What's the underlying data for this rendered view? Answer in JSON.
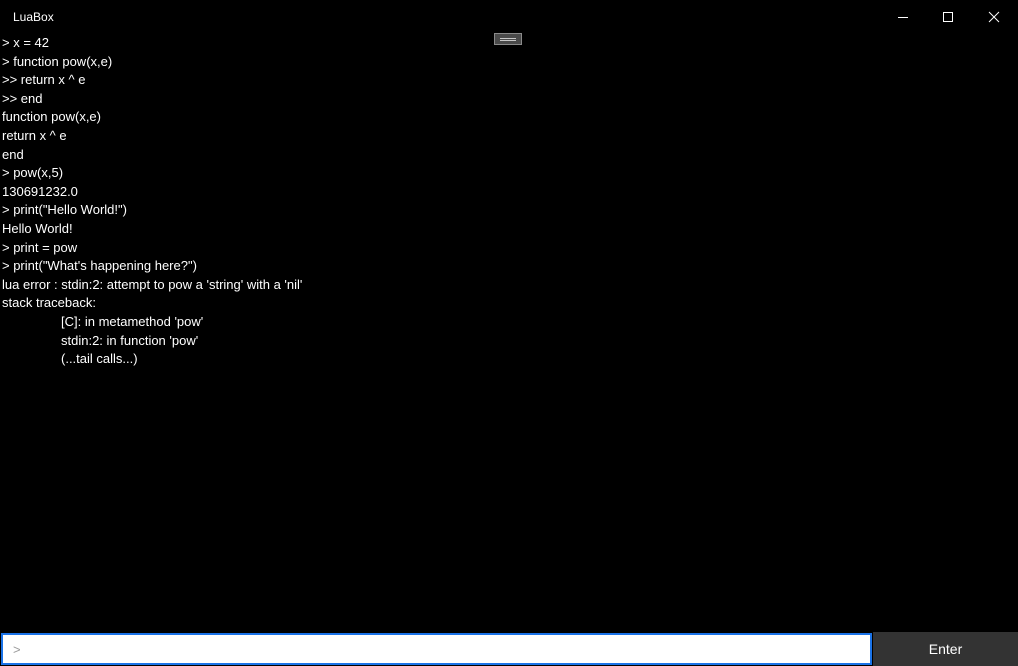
{
  "window": {
    "title": "LuaBox"
  },
  "console": {
    "lines": [
      {
        "text": "> x = 42",
        "indent": false
      },
      {
        "text": "> function pow(x,e)",
        "indent": false
      },
      {
        "text": ">> return x ^ e",
        "indent": false
      },
      {
        "text": ">> end",
        "indent": false
      },
      {
        "text": "function pow(x,e)",
        "indent": false
      },
      {
        "text": "return x ^ e",
        "indent": false
      },
      {
        "text": "end",
        "indent": false
      },
      {
        "text": "> pow(x,5)",
        "indent": false
      },
      {
        "text": "130691232.0",
        "indent": false
      },
      {
        "text": "> print(\"Hello World!\")",
        "indent": false
      },
      {
        "text": "Hello World!",
        "indent": false
      },
      {
        "text": "> print = pow",
        "indent": false
      },
      {
        "text": "> print(\"What's happening here?\")",
        "indent": false
      },
      {
        "text": "lua error : stdin:2: attempt to pow a 'string' with a 'nil'",
        "indent": false
      },
      {
        "text": "stack traceback:",
        "indent": false
      },
      {
        "text": "[C]: in metamethod 'pow'",
        "indent": true
      },
      {
        "text": "stdin:2: in function 'pow'",
        "indent": true
      },
      {
        "text": "(...tail calls...)",
        "indent": true
      }
    ]
  },
  "input": {
    "value": "",
    "placeholder": ">",
    "enter_label": "Enter"
  },
  "icons": {
    "minimize": "minimize-icon",
    "maximize": "maximize-icon",
    "close": "close-icon"
  },
  "colors": {
    "background": "#000000",
    "text": "#ffffff",
    "input_border": "#1a73e8",
    "button_bg": "#333333"
  }
}
